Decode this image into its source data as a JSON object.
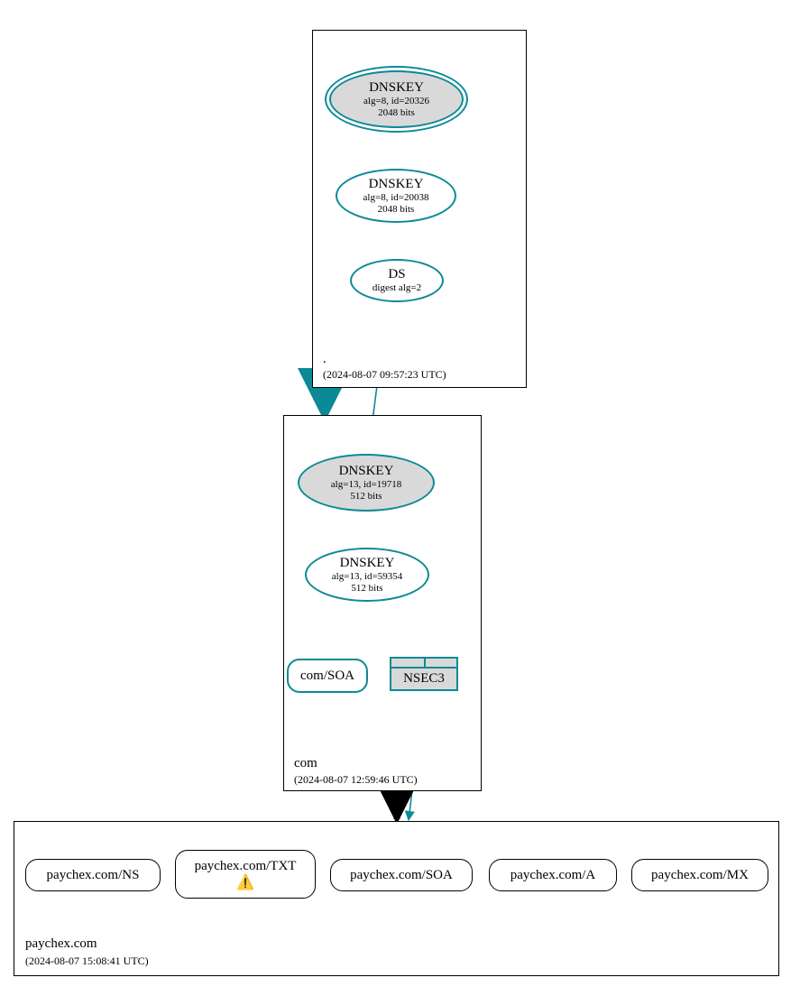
{
  "zones": {
    "root": {
      "label": ".",
      "timestamp": "(2024-08-07 09:57:23 UTC)",
      "nodes": {
        "ksk": {
          "title": "DNSKEY",
          "sub1": "alg=8, id=20326",
          "sub2": "2048 bits"
        },
        "zsk": {
          "title": "DNSKEY",
          "sub1": "alg=8, id=20038",
          "sub2": "2048 bits"
        },
        "ds": {
          "title": "DS",
          "sub1": "digest alg=2"
        }
      }
    },
    "com": {
      "label": "com",
      "timestamp": "(2024-08-07 12:59:46 UTC)",
      "nodes": {
        "ksk": {
          "title": "DNSKEY",
          "sub1": "alg=13, id=19718",
          "sub2": "512 bits"
        },
        "zsk": {
          "title": "DNSKEY",
          "sub1": "alg=13, id=59354",
          "sub2": "512 bits"
        },
        "soa": {
          "label": "com/SOA"
        },
        "nsec3": {
          "label": "NSEC3"
        }
      }
    },
    "paychex": {
      "label": "paychex.com",
      "timestamp": "(2024-08-07 15:08:41 UTC)",
      "records": {
        "ns": "paychex.com/NS",
        "txt": "paychex.com/TXT",
        "soa": "paychex.com/SOA",
        "a": "paychex.com/A",
        "mx": "paychex.com/MX"
      },
      "txt_warning": true
    }
  }
}
